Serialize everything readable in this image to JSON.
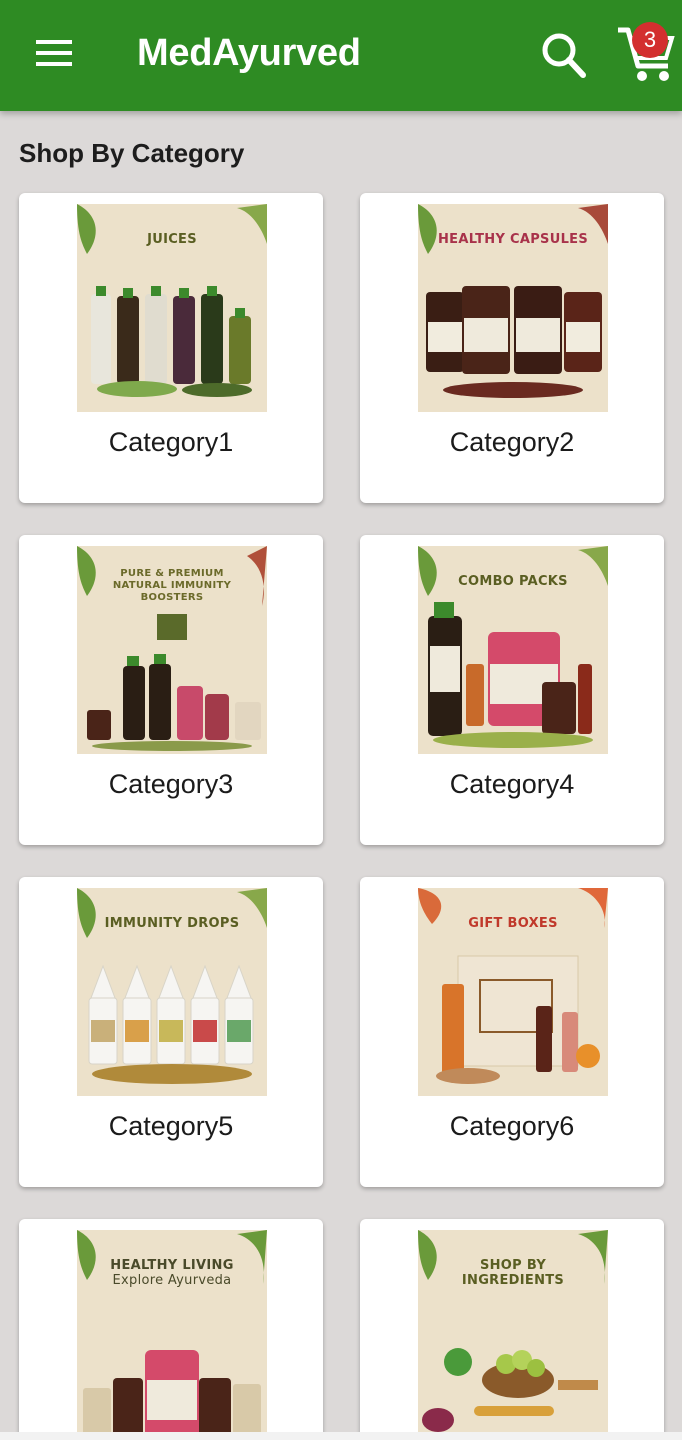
{
  "appbar": {
    "title": "MedAyurved",
    "cart_count": "3",
    "background": "#2e8b23"
  },
  "section": {
    "title": "Shop By Category"
  },
  "categories": [
    {
      "label": "Category1",
      "image_text": [
        "JUICES"
      ],
      "image_text_color": "#5a5e22"
    },
    {
      "label": "Category2",
      "image_text": [
        "HEALTHY CAPSULES"
      ],
      "image_text_color": "#a8324a"
    },
    {
      "label": "Category3",
      "image_text": [
        "PURE & PREMIUM",
        "NATURAL IMMUNITY",
        "BOOSTERS"
      ],
      "image_text_color": "#6b6a2a"
    },
    {
      "label": "Category4",
      "image_text": [
        "COMBO PACKS"
      ],
      "image_text_color": "#5a5e22"
    },
    {
      "label": "Category5",
      "image_text": [
        "IMMUNITY DROPS"
      ],
      "image_text_color": "#5a5e22"
    },
    {
      "label": "Category6",
      "image_text": [
        "GIFT BOXES"
      ],
      "image_text_color": "#c0392b"
    },
    {
      "label": "",
      "image_text": [
        "HEALTHY LIVING",
        "Explore Ayurveda"
      ],
      "image_text_color": "#4a4a2a"
    },
    {
      "label": "",
      "image_text": [
        "SHOP BY",
        "INGREDIENTS"
      ],
      "image_text_color": "#5a5e22"
    }
  ],
  "icons": {
    "menu": "hamburger-icon",
    "search": "search-icon",
    "cart": "cart-icon"
  }
}
